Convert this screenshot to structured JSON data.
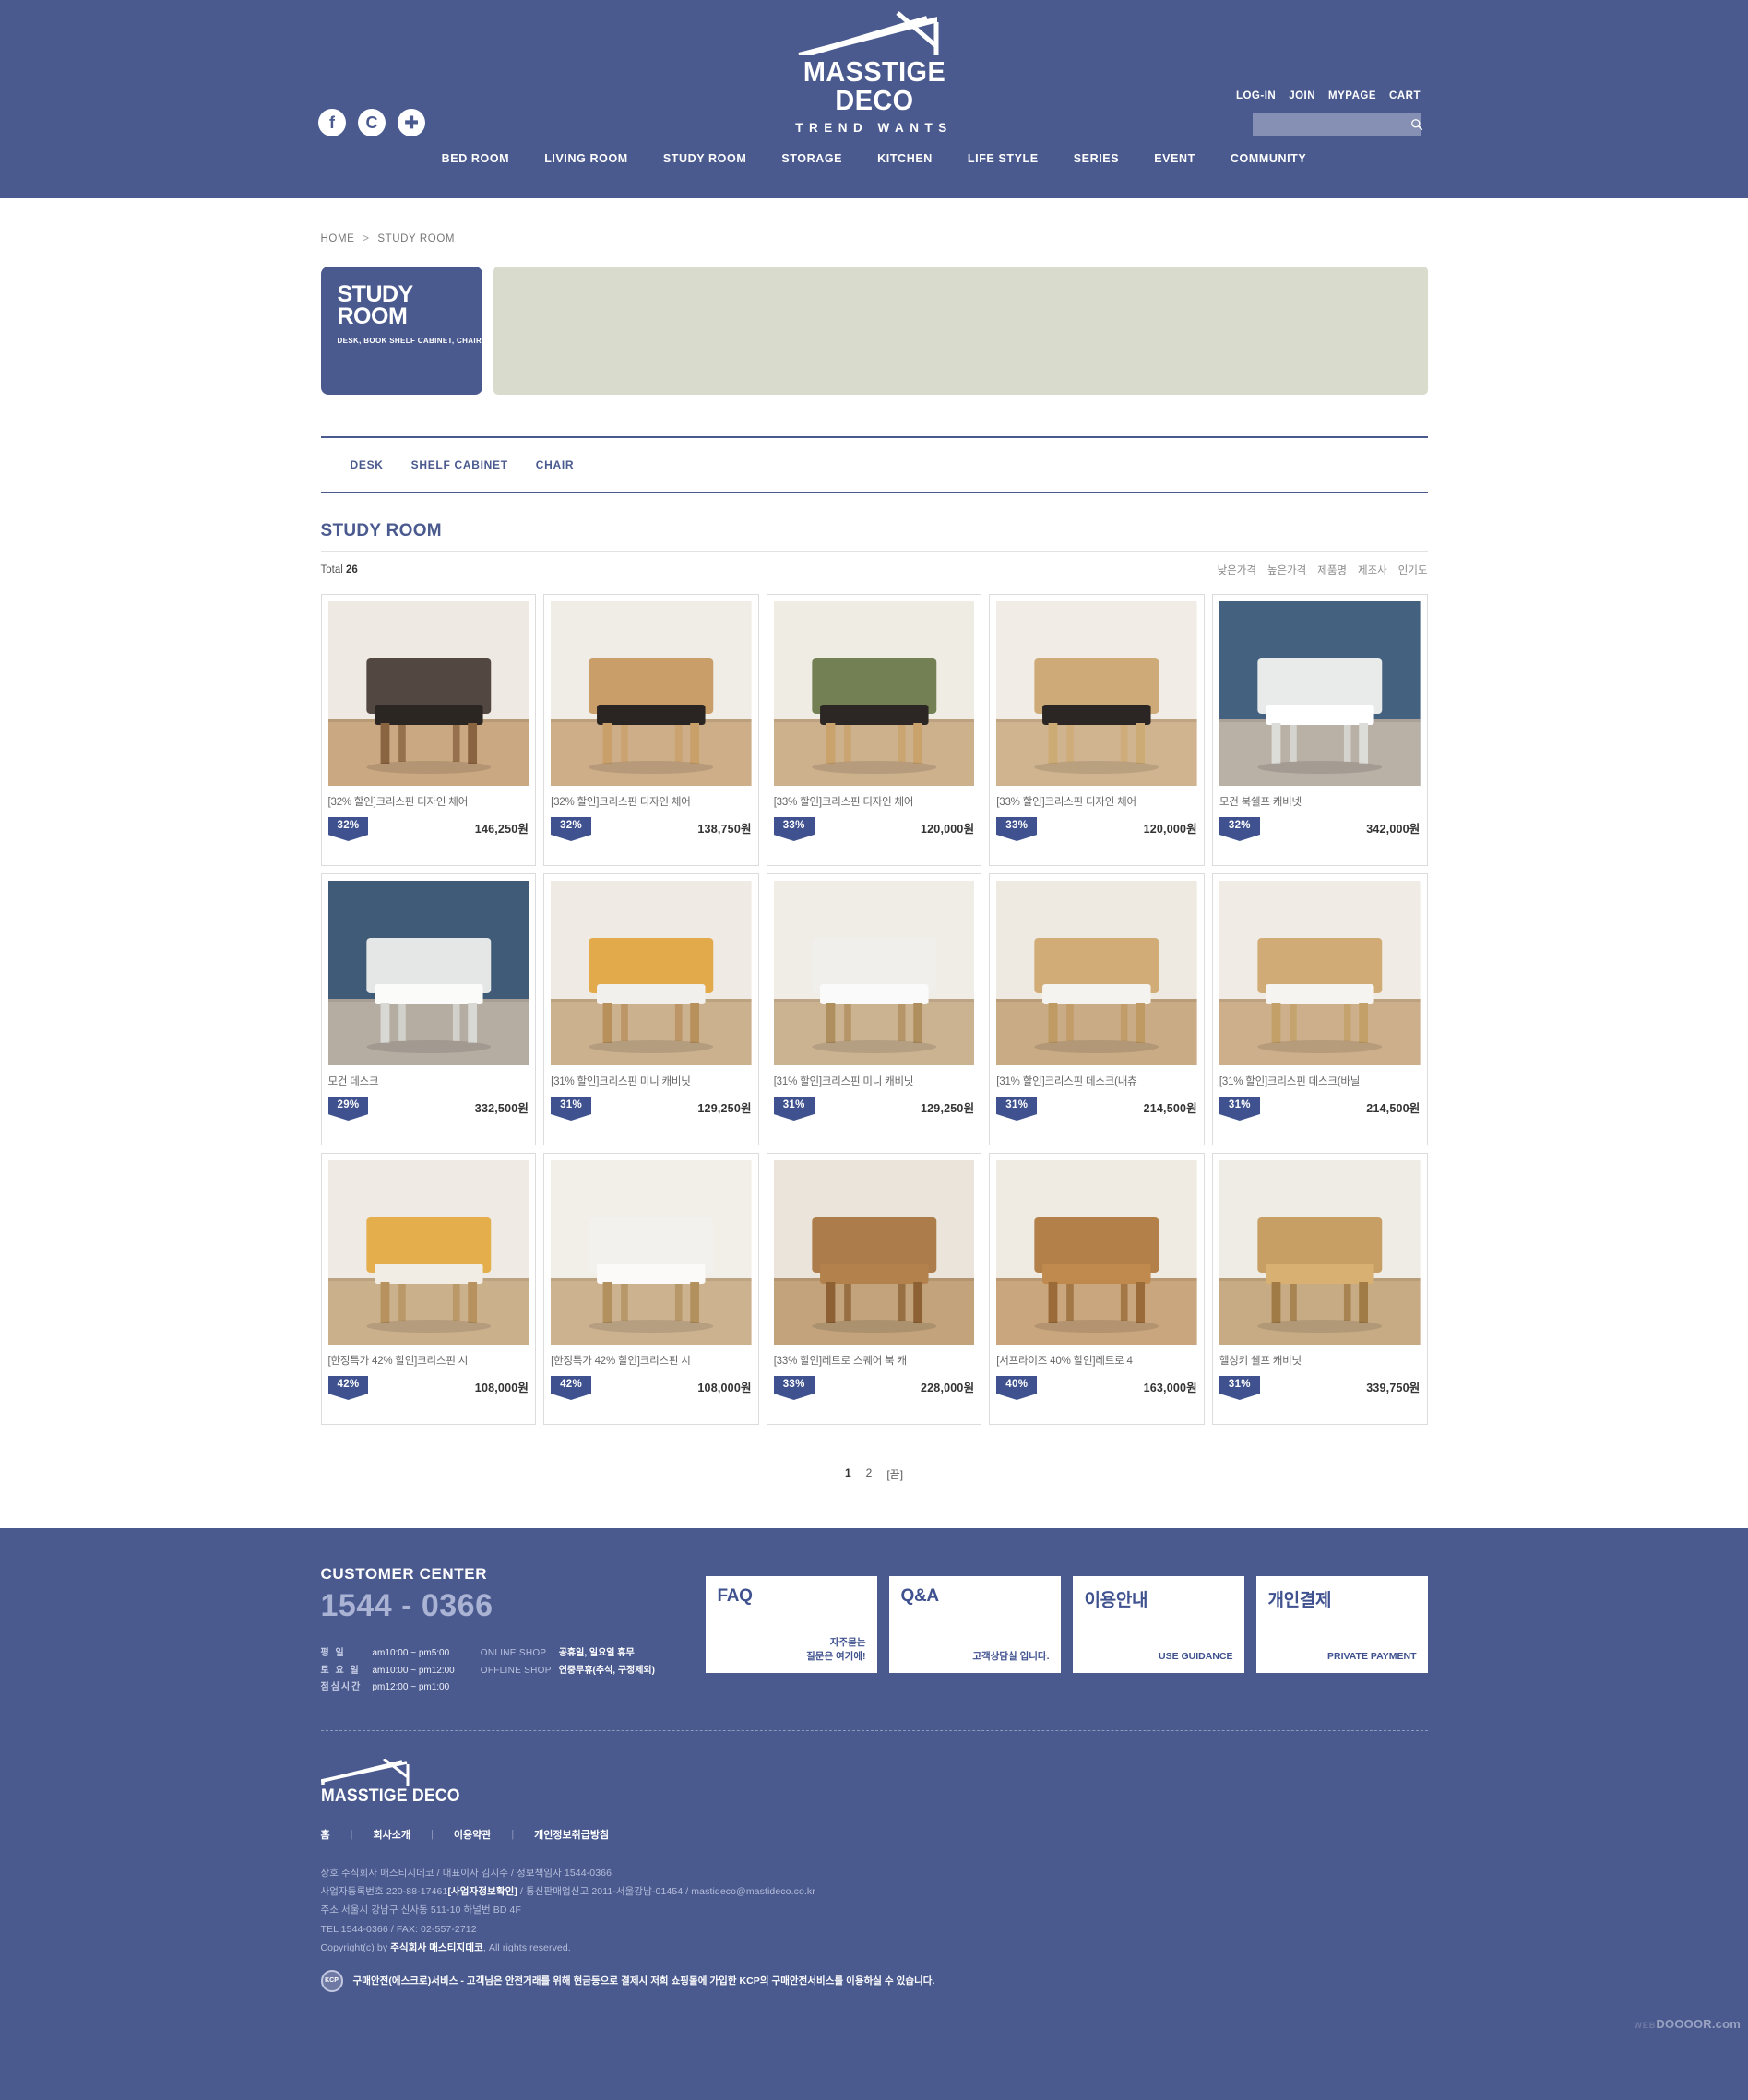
{
  "brand": {
    "name": "MASSTIGE DECO",
    "tagline": "TREND WANTS",
    "accent": "#4a5a8f",
    "ribbon": "#3f528f"
  },
  "header": {
    "social": [
      {
        "name": "facebook-icon",
        "glyph": "f"
      },
      {
        "name": "cyworld-icon",
        "glyph": "C"
      },
      {
        "name": "plus-icon",
        "glyph": "✚"
      }
    ],
    "utils": [
      {
        "label": "LOG-IN"
      },
      {
        "label": "JOIN"
      },
      {
        "label": "MYPAGE"
      },
      {
        "label": "CART"
      }
    ],
    "search": {
      "value": "",
      "placeholder": "",
      "icon": "search-icon"
    },
    "nav": [
      {
        "label": "BED ROOM"
      },
      {
        "label": "LIVING ROOM"
      },
      {
        "label": "STUDY ROOM"
      },
      {
        "label": "STORAGE"
      },
      {
        "label": "KITCHEN"
      },
      {
        "label": "LIFE STYLE"
      },
      {
        "label": "SERIES"
      },
      {
        "label": "EVENT"
      },
      {
        "label": "COMMUNITY"
      }
    ]
  },
  "breadcrumb": {
    "home": "HOME",
    "sep": ">",
    "current": "STUDY ROOM"
  },
  "category_banner": {
    "line1": "STUDY",
    "line2": "ROOM",
    "sub": "DESK, BOOK SHELF CABINET, CHAIR",
    "visual_color": "#d9dbcd"
  },
  "subnav": [
    {
      "label": "DESK"
    },
    {
      "label": "SHELF CABINET"
    },
    {
      "label": "CHAIR"
    }
  ],
  "listing": {
    "title": "STUDY ROOM",
    "total_label": "Total",
    "total_count": "26",
    "sorts": [
      {
        "label": "낮은가격"
      },
      {
        "label": "높은가격"
      },
      {
        "label": "제품명"
      },
      {
        "label": "제조사"
      },
      {
        "label": "인기도"
      }
    ]
  },
  "products": [
    {
      "name": "[32% 할인]크리스핀 디자인 체어",
      "discount": "32%",
      "price": "146,250원",
      "image": "chair-dark-brown"
    },
    {
      "name": "[32% 할인]크리스핀 디자인 체어",
      "discount": "32%",
      "price": "138,750원",
      "image": "chair-natural-wood"
    },
    {
      "name": "[33% 할인]크리스핀 디자인 체어",
      "discount": "33%",
      "price": "120,000원",
      "image": "chair-olive-green"
    },
    {
      "name": "[33% 할인]크리스핀 디자인 체어",
      "discount": "33%",
      "price": "120,000원",
      "image": "chair-light-oak"
    },
    {
      "name": "모건 북쉘프 캐비넷",
      "discount": "32%",
      "price": "342,000원",
      "image": "white-bookshelf-blue-wall"
    },
    {
      "name": "모건 데스크",
      "discount": "29%",
      "price": "332,500원",
      "image": "white-desk-blue-wall"
    },
    {
      "name": "[31% 할인]크리스핀 미니 캐비닛",
      "discount": "31%",
      "price": "129,250원",
      "image": "mini-cabinet-yellow"
    },
    {
      "name": "[31% 할인]크리스핀 미니 캐비닛",
      "discount": "31%",
      "price": "129,250원",
      "image": "mini-cabinet-white"
    },
    {
      "name": "[31% 할인]크리스핀 데스크(내츄",
      "discount": "31%",
      "price": "214,500원",
      "image": "desk-natural-green-lamp"
    },
    {
      "name": "[31% 할인]크리스핀 데스크(바닐",
      "discount": "31%",
      "price": "214,500원",
      "image": "desk-vanilla-laptop"
    },
    {
      "name": "[한정특가 42% 할인]크리스핀 시",
      "discount": "42%",
      "price": "108,000원",
      "image": "nightstand-yellow-bed"
    },
    {
      "name": "[한정특가 42% 할인]크리스핀 시",
      "discount": "42%",
      "price": "108,000원",
      "image": "nightstand-white-bed"
    },
    {
      "name": "[33% 할인]레트로 스퀘어 북 캐",
      "discount": "33%",
      "price": "228,000원",
      "image": "retro-square-bookcase"
    },
    {
      "name": "[서프라이즈 40% 할인]레트로 4",
      "discount": "40%",
      "price": "163,000원",
      "image": "retro-wood-table"
    },
    {
      "name": "헬싱키 쉘프 캐비닛",
      "discount": "31%",
      "price": "339,750원",
      "image": "helsinki-shelf-cabinet"
    }
  ],
  "pagination": [
    {
      "label": "1",
      "current": true
    },
    {
      "label": "2",
      "current": false
    },
    {
      "label": "[끝]",
      "current": false
    }
  ],
  "footer": {
    "customer_center": {
      "title": "CUSTOMER CENTER",
      "phone": "1544 - 0366",
      "hours": [
        {
          "label": "평    일",
          "value": "am10:00 ~ pm5:00"
        },
        {
          "label": "토 요 일",
          "value": "am10:00 ~ pm12:00"
        },
        {
          "label": "점심시간",
          "value": "pm12:00 ~ pm1:00"
        }
      ],
      "shops": [
        {
          "label": "ONLINE SHOP",
          "value": "공휴일, 일요일 휴무"
        },
        {
          "label": "OFFLINE SHOP",
          "value": "연중무휴(추석, 구정제외)"
        }
      ]
    },
    "boxes": [
      {
        "title": "FAQ",
        "sub": "자주묻는\n질문은 여기에!"
      },
      {
        "title": "Q&A",
        "sub": "고객상담실 입니다."
      },
      {
        "title": "이용안내",
        "sub": "USE GUIDANCE"
      },
      {
        "title": "개인결제",
        "sub": "PRIVATE PAYMENT"
      }
    ],
    "links": [
      {
        "label": "홈"
      },
      {
        "label": "회사소개"
      },
      {
        "label": "이용약관"
      },
      {
        "label": "개인정보취급방침"
      }
    ],
    "divider": "|",
    "info": {
      "line1": "상호 주식회사 매스티지데코 / 대표이사 김지수 / 정보책임자 1544-0366",
      "line2_a": "사업자등록번호 220-88-17461",
      "line2_b": "[사업자정보확인]",
      "line2_c": " / 통신판매업신고 2011-서울강남-01454 / mastideco@mastideco.co.kr",
      "line3": "주소 서울시 강남구 신사동 511-10 하널번 BD 4F",
      "line4": "TEL 1544-0366 / FAX: 02-557-2712",
      "line5_a": "Copyright(c) by ",
      "line5_b": "주식회사 매스티지데코",
      "line5_c": ", All rights reserved."
    },
    "escrow": {
      "badge": "KCP",
      "text": "구매안전(에스크로)서비스 - 고객님은 안전거래를 위해 현금등으로 결제시 저희 쇼핑몰에 가입한 KCP의 구매안전서비스를 이용하실 수 있습니다."
    }
  },
  "watermark": {
    "prefix": "WEB",
    "main": "DOOOOR.com"
  }
}
